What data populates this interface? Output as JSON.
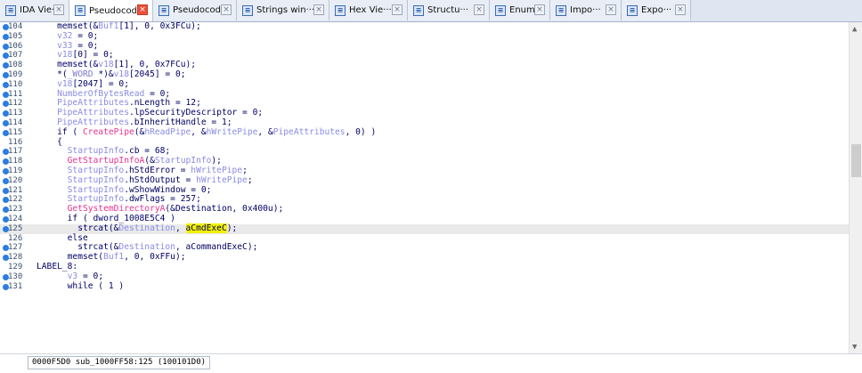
{
  "tabs": [
    {
      "label": "IDA Vie···",
      "icon": "ida-view-icon",
      "active": false
    },
    {
      "label": "Pseudocod···",
      "icon": "pseudocode-icon",
      "active": true
    },
    {
      "label": "Pseudocod···",
      "icon": "pseudocode-icon",
      "active": false
    },
    {
      "label": "Strings win···",
      "icon": "strings-icon",
      "active": false
    },
    {
      "label": "Hex Vie···",
      "icon": "hex-view-icon",
      "active": false
    },
    {
      "label": "Structu···",
      "icon": "structures-icon",
      "active": false
    },
    {
      "label": "Enums",
      "icon": "enums-icon",
      "active": false
    },
    {
      "label": "Impo···",
      "icon": "imports-icon",
      "active": false
    },
    {
      "label": "Expo···",
      "icon": "exports-icon",
      "active": false
    }
  ],
  "code_lines": [
    {
      "num": "104",
      "bp": true,
      "text": "    memset(&Buf1[1], 0, 0x3FCu);"
    },
    {
      "num": "105",
      "bp": true,
      "text": "    v32 = 0;"
    },
    {
      "num": "106",
      "bp": true,
      "text": "    v33 = 0;"
    },
    {
      "num": "107",
      "bp": true,
      "text": "    v18[0] = 0;"
    },
    {
      "num": "108",
      "bp": true,
      "text": "    memset(&v18[1], 0, 0x7FCu);"
    },
    {
      "num": "109",
      "bp": true,
      "text": "    *(_WORD *)&v18[2045] = 0;"
    },
    {
      "num": "110",
      "bp": true,
      "text": "    v18[2047] = 0;"
    },
    {
      "num": "111",
      "bp": true,
      "text": "    NumberOfBytesRead = 0;"
    },
    {
      "num": "112",
      "bp": true,
      "text": "    PipeAttributes.nLength = 12;"
    },
    {
      "num": "113",
      "bp": true,
      "text": "    PipeAttributes.lpSecurityDescriptor = 0;"
    },
    {
      "num": "114",
      "bp": true,
      "text": "    PipeAttributes.bInheritHandle = 1;"
    },
    {
      "num": "115",
      "bp": true,
      "text": "    if ( CreatePipe(&hReadPipe, &hWritePipe, &PipeAttributes, 0) )"
    },
    {
      "num": "116",
      "bp": false,
      "text": "    {"
    },
    {
      "num": "117",
      "bp": true,
      "text": "      StartupInfo.cb = 68;"
    },
    {
      "num": "118",
      "bp": true,
      "text": "      GetStartupInfoA(&StartupInfo);"
    },
    {
      "num": "119",
      "bp": true,
      "text": "      StartupInfo.hStdError = hWritePipe;"
    },
    {
      "num": "120",
      "bp": true,
      "text": "      StartupInfo.hStdOutput = hWritePipe;"
    },
    {
      "num": "121",
      "bp": true,
      "text": "      StartupInfo.wShowWindow = 0;"
    },
    {
      "num": "122",
      "bp": true,
      "text": "      StartupInfo.dwFlags = 257;"
    },
    {
      "num": "123",
      "bp": true,
      "text": "      GetSystemDirectoryA(&Destination, 0x400u);"
    },
    {
      "num": "124",
      "bp": true,
      "text": "      if ( dword_1008E5C4 )"
    },
    {
      "num": "125",
      "bp": true,
      "text": "        strcat(&Destination, aCmdExeC);"
    },
    {
      "num": "126",
      "bp": false,
      "text": "      else"
    },
    {
      "num": "127",
      "bp": true,
      "text": "        strcat(&Destination, aCommandExeC);"
    },
    {
      "num": "128",
      "bp": true,
      "text": "      memset(Buf1, 0, 0xFFu);"
    },
    {
      "num": "129",
      "bp": false,
      "text": "LABEL_8:"
    },
    {
      "num": "130",
      "bp": true,
      "text": "      v3 = 0;"
    },
    {
      "num": "131",
      "bp": true,
      "text": "      while ( 1 )"
    }
  ],
  "status": {
    "text": "0000F5D0 sub_1000FF58:125 (100101D0)"
  },
  "colors": {
    "keyword": "#000066",
    "variable": "#8a8ae6",
    "function": "#e8338e",
    "highlight": "#f2f200"
  }
}
